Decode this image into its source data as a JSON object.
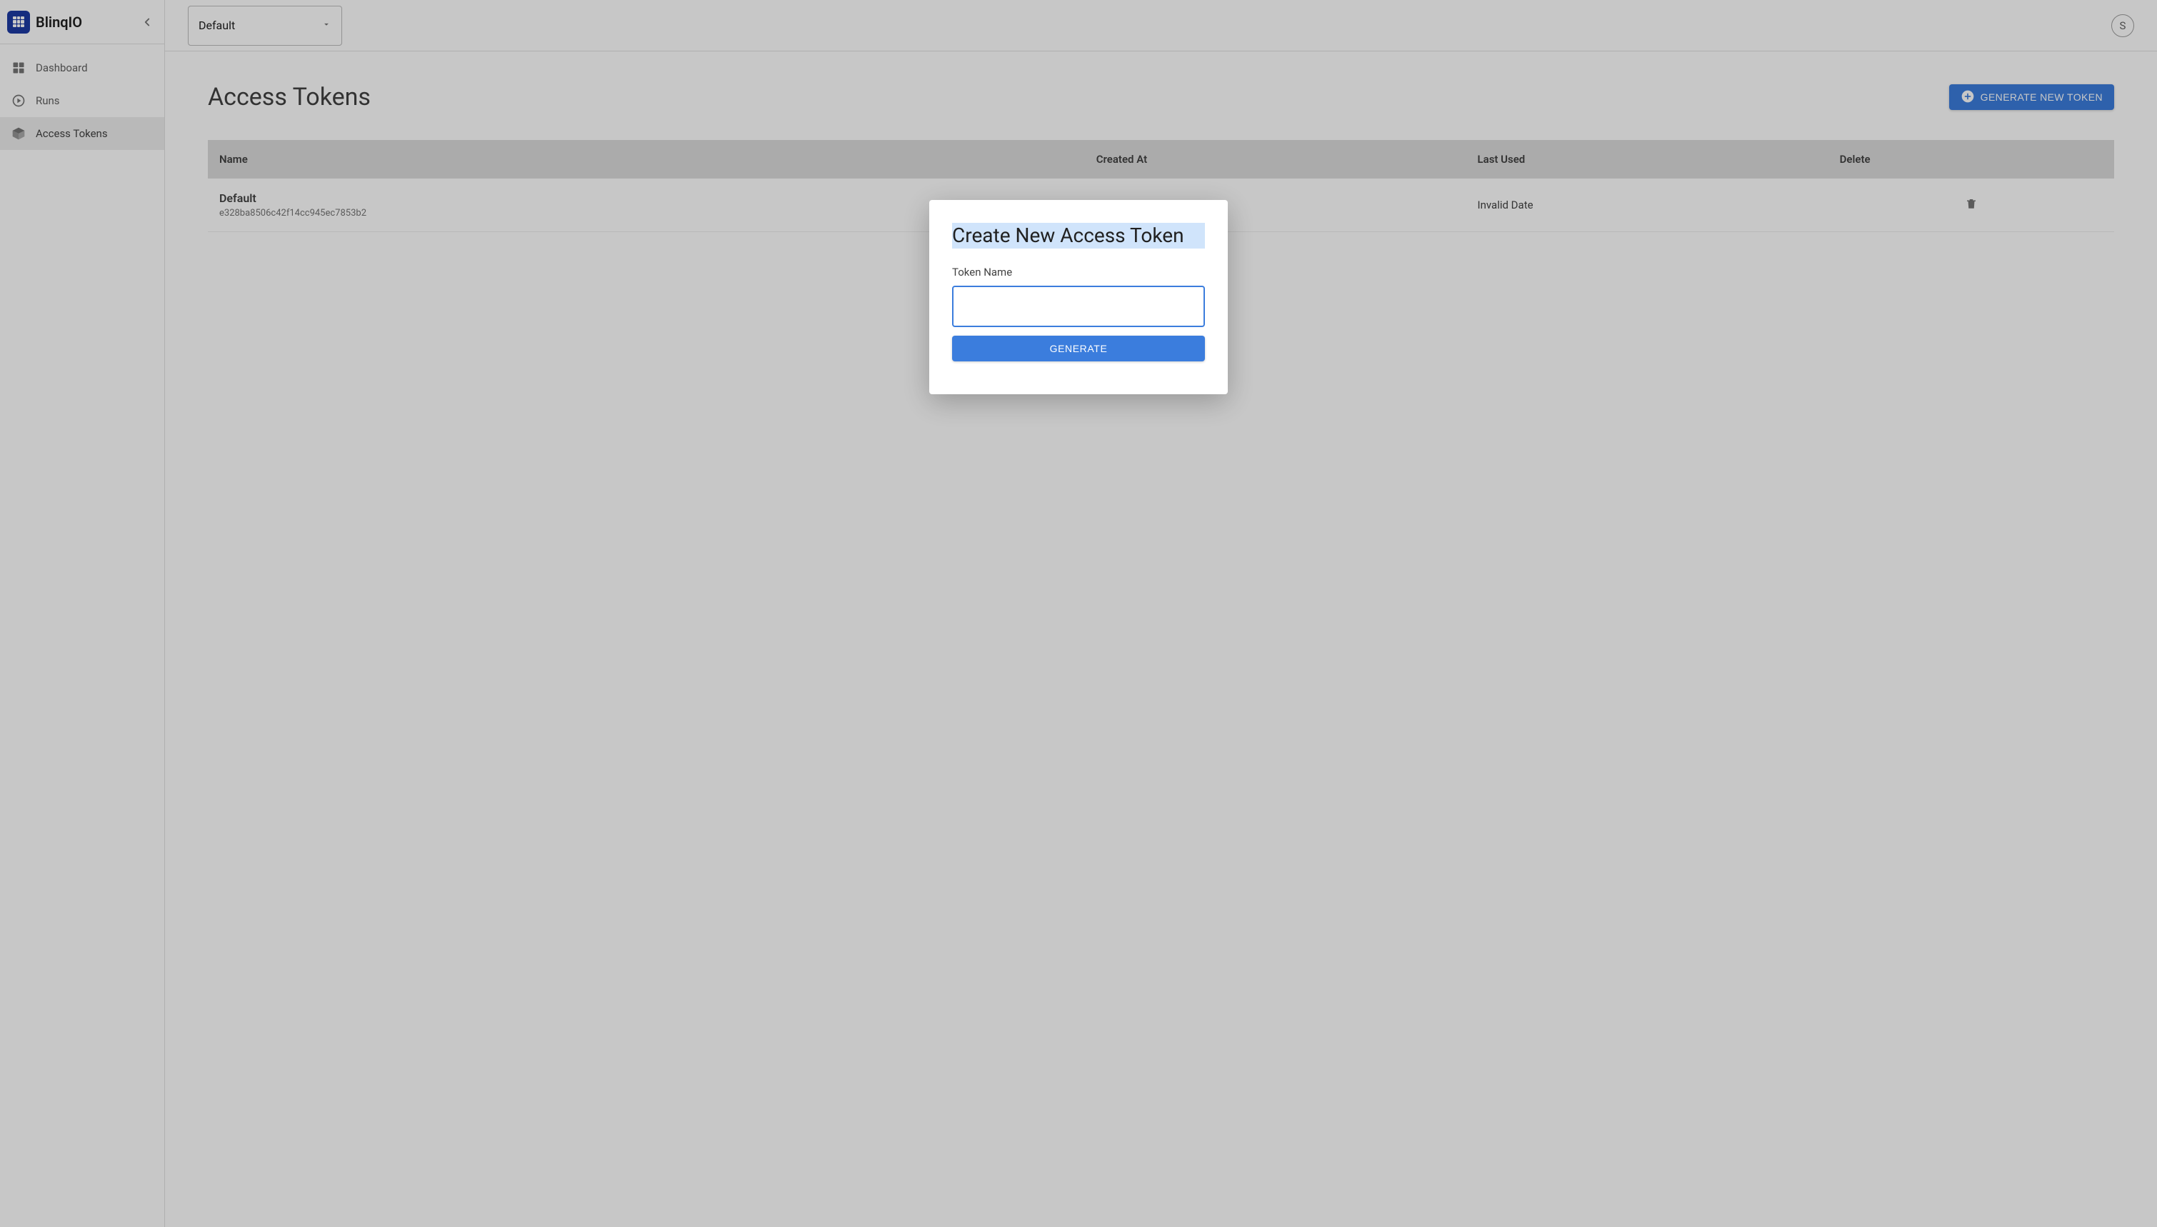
{
  "brand": {
    "name": "BlinqIO"
  },
  "sidebar": {
    "items": [
      {
        "label": "Dashboard"
      },
      {
        "label": "Runs"
      },
      {
        "label": "Access Tokens"
      }
    ],
    "active_index": 2
  },
  "topbar": {
    "project_select": {
      "value": "Default"
    },
    "avatar_initial": "S"
  },
  "page": {
    "title": "Access Tokens",
    "generate_button": "GENERATE NEW TOKEN"
  },
  "table": {
    "headers": {
      "name": "Name",
      "created_at": "Created At",
      "last_used": "Last Used",
      "delete": "Delete"
    },
    "rows": [
      {
        "name": "Default",
        "hash": "e328ba8506c42f14cc945ec7853b2",
        "created_at": "",
        "last_used": "Invalid Date"
      }
    ]
  },
  "modal": {
    "title": "Create New Access Token",
    "field_label": "Token Name",
    "input_value": "",
    "generate_button": "GENERATE"
  }
}
